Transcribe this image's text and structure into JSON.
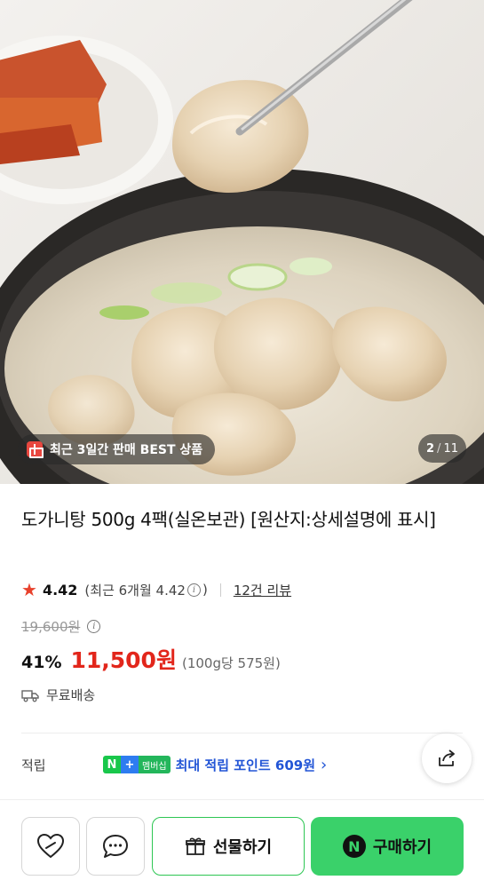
{
  "hero": {
    "badge_text": "최근 3일간 판매 BEST 상품",
    "counter_current": "2",
    "counter_sep": "/",
    "counter_total": "11"
  },
  "product": {
    "title": "도가니탕 500g 4팩(실온보관) [원산지:상세설명에 표시]",
    "rating": "4.42",
    "rating_recent_prefix": "(최근 6개월 4.42",
    "rating_recent_suffix": ")",
    "review_count": "12건 리뷰",
    "original_price": "19,600원",
    "discount": "41%",
    "sale_price": "11,500원",
    "unit_price": "(100g당 575원)",
    "shipping": "무료배송"
  },
  "points": {
    "label": "적립",
    "badge_n": "N",
    "badge_plus": "+",
    "badge_member": "멤버십",
    "text": "최대 적립 포인트 609원"
  },
  "bottom_bar": {
    "gift_label": "선물하기",
    "buy_label": "구매하기",
    "buy_badge": "N"
  },
  "colors": {
    "sale_red": "#e2261b",
    "naver_green": "#3ad16a",
    "points_blue": "#2255d6",
    "star": "#e8412c"
  }
}
